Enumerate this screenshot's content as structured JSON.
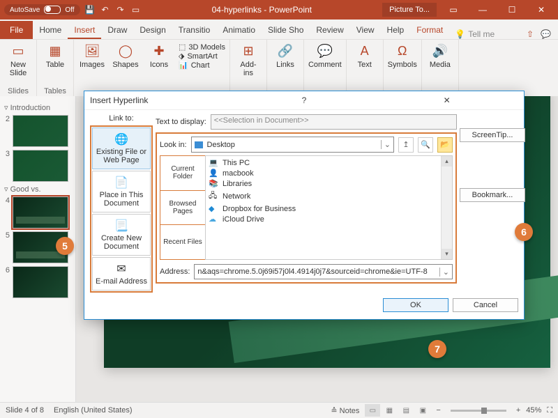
{
  "titlebar": {
    "autosave": "AutoSave",
    "off": "Off",
    "title": "04-hyperlinks - PowerPoint",
    "context": "Picture To..."
  },
  "tabs": {
    "file": "File",
    "home": "Home",
    "insert": "Insert",
    "draw": "Draw",
    "design": "Design",
    "transitions": "Transitio",
    "animations": "Animatio",
    "slideshow": "Slide Sho",
    "review": "Review",
    "view": "View",
    "help": "Help",
    "format": "Format",
    "tellme": "Tell me"
  },
  "ribbon": {
    "newslide": "New\nSlide",
    "slides_lbl": "Slides",
    "table": "Table",
    "tables_lbl": "Tables",
    "images": "Images",
    "shapes": "Shapes",
    "icons": "Icons",
    "models": "3D Models",
    "smartart": "SmartArt",
    "chart": "Chart",
    "addins": "Add-\nins",
    "links": "Links",
    "comment": "Comment",
    "text": "Text",
    "symbols": "Symbols",
    "media": "Media"
  },
  "thumbs": {
    "sec1": "Introduction",
    "sec2": "Good vs."
  },
  "dialog": {
    "title": "Insert Hyperlink",
    "linkto": "Link to:",
    "texttodisplay": "Text to display:",
    "selection": "<<Selection in Document>>",
    "screentip": "ScreenTip...",
    "existing": "Existing File or Web Page",
    "place": "Place in This Document",
    "createnew": "Create New Document",
    "email": "E-mail Address",
    "lookin": "Look in:",
    "desktop": "Desktop",
    "current": "Current Folder",
    "browsed": "Browsed Pages",
    "recent": "Recent Files",
    "items": {
      "thispc": "This PC",
      "macbook": "macbook",
      "libraries": "Libraries",
      "network": "Network",
      "dropbox": "Dropbox for Business",
      "icloud": "iCloud Drive"
    },
    "address": "Address:",
    "url": "n&aqs=chrome.5.0j69i57j0l4.4914j0j7&sourceid=chrome&ie=UTF-8",
    "bookmark": "Bookmark...",
    "ok": "OK",
    "cancel": "Cancel"
  },
  "status": {
    "slide": "Slide 4 of 8",
    "lang": "English (United States)",
    "notes": "Notes",
    "zoom": "45%"
  },
  "callouts": {
    "c5": "5",
    "c6": "6",
    "c7": "7"
  }
}
